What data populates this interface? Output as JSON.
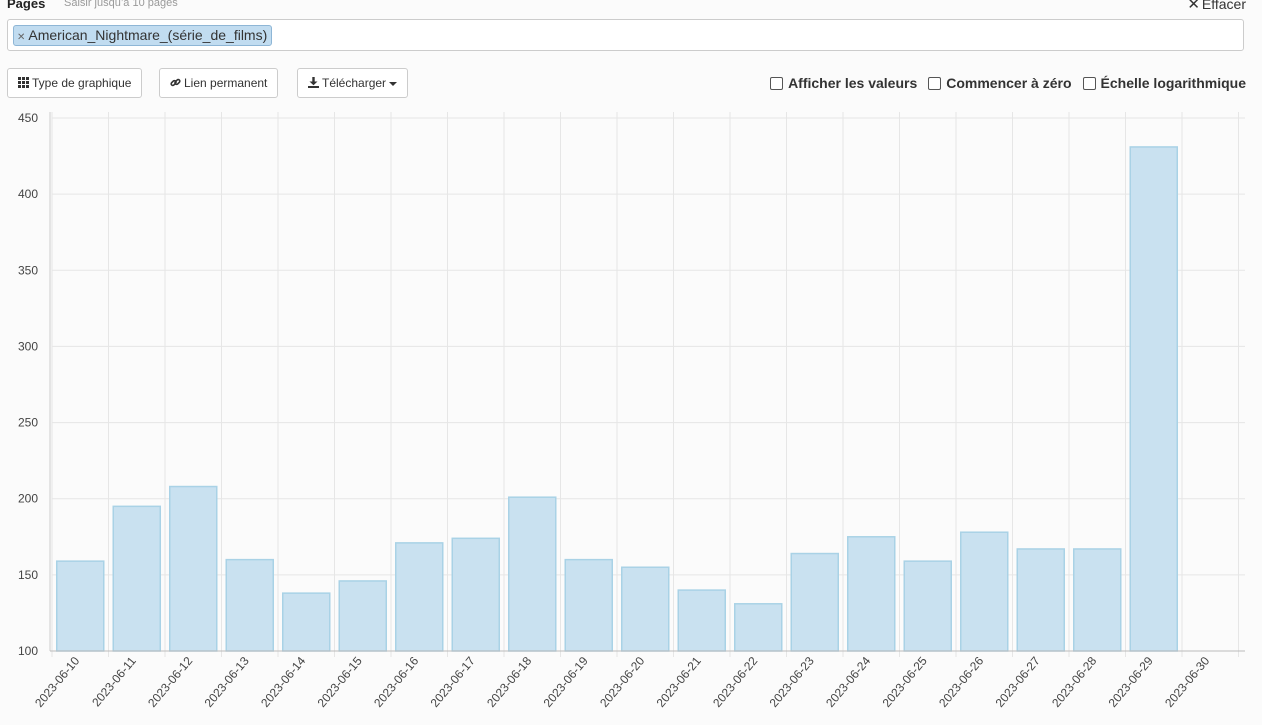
{
  "header": {
    "pages_label": "Pages",
    "pages_hint": "Saisir jusqu’à 10 pages",
    "clear_label": "Effacer"
  },
  "tags": [
    "American_Nightmare_(série_de_films)"
  ],
  "toolbar": {
    "chart_type_label": "Type de graphique",
    "permalink_label": "Lien permanent",
    "download_label": "Télécharger"
  },
  "options": {
    "show_values": "Afficher les valeurs",
    "start_zero": "Commencer à zéro",
    "log_scale": "Échelle logarithmique"
  },
  "icons": {
    "clear": "close-icon",
    "tag_remove": "close-icon",
    "chart_type": "grid-icon",
    "permalink": "link-icon",
    "download": "download-icon"
  },
  "colors": {
    "bar_fill": "#c9e1f0",
    "bar_stroke": "#a9d2e6",
    "grid": "#e6e6e6",
    "tag_fill": "#c1dcf0"
  },
  "chart_data": {
    "type": "bar",
    "categories": [
      "2023-06-10",
      "2023-06-11",
      "2023-06-12",
      "2023-06-13",
      "2023-06-14",
      "2023-06-15",
      "2023-06-16",
      "2023-06-17",
      "2023-06-18",
      "2023-06-19",
      "2023-06-20",
      "2023-06-21",
      "2023-06-22",
      "2023-06-23",
      "2023-06-24",
      "2023-06-25",
      "2023-06-26",
      "2023-06-27",
      "2023-06-28",
      "2023-06-29",
      "2023-06-30"
    ],
    "values": [
      159,
      195,
      208,
      160,
      138,
      146,
      171,
      174,
      201,
      160,
      155,
      140,
      131,
      164,
      175,
      159,
      178,
      167,
      167,
      431,
      null
    ],
    "y_ticks": [
      100,
      150,
      200,
      250,
      300,
      350,
      400,
      450
    ],
    "ylim": [
      100,
      450
    ],
    "grid": true
  }
}
